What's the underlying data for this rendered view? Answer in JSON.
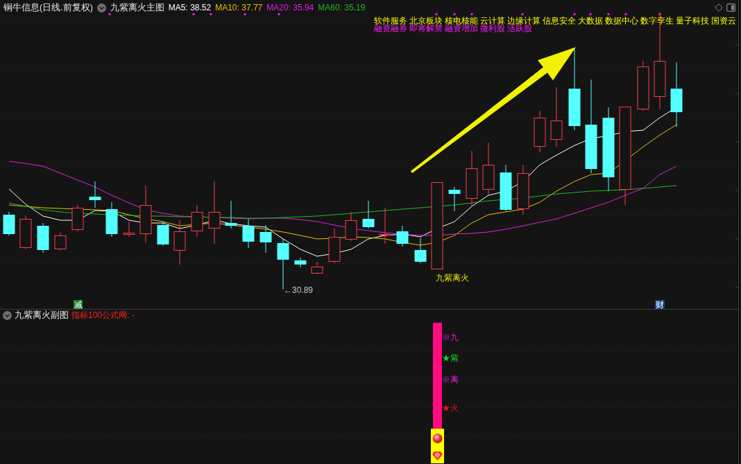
{
  "header": {
    "stock_title": "铜牛信息(日线.前复权)",
    "indicator": "九紫离火主图",
    "ma_values": [
      {
        "label": "MA5: 38.52",
        "color": "#ffffff"
      },
      {
        "label": "MA10: 37.77",
        "color": "#e6c200"
      },
      {
        "label": "MA20: 35.94",
        "color": "#e020e0"
      },
      {
        "label": "MA60: 35.19",
        "color": "#22b822"
      }
    ]
  },
  "concept_tags": [
    "软件服务",
    "北京板块",
    "核电核能",
    "云计算",
    "边缘计算",
    "信息安全",
    "大数据",
    "数据中心",
    "数字孪生",
    "量子科技",
    "国资云"
  ],
  "feature_tags": [
    "融资融券",
    "即将解禁",
    "融资增加",
    "微利股",
    "活跃股"
  ],
  "chart": {
    "signal_label": "九紫离火",
    "low_label": "←30.89",
    "markers": [
      {
        "text": "减",
        "color": "#16801e"
      },
      {
        "text": "财",
        "color": "#0f4b86"
      }
    ]
  },
  "sub_chart": {
    "title": "九紫离火副图",
    "source": "指标100公式网: -",
    "signals": [
      {
        "text": "※九",
        "color": "#e020e0"
      },
      {
        "text": "★紫",
        "color": "#20d020"
      },
      {
        "text": "※离",
        "color": "#e020e0"
      },
      {
        "text": "★火",
        "color": "#ff1010"
      }
    ]
  }
}
